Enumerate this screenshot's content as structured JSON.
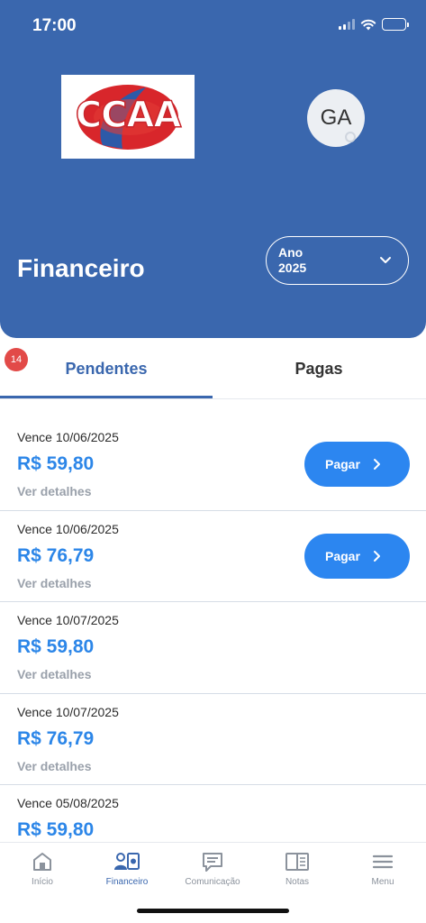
{
  "status_bar": {
    "time": "17:00"
  },
  "header": {
    "logo_text": "CCAA",
    "avatar_initials": "GA",
    "title": "Financeiro",
    "year_select": {
      "label": "Ano",
      "value": "2025"
    }
  },
  "tabs": [
    {
      "label": "Pendentes",
      "active": true,
      "badge": "14"
    },
    {
      "label": "Pagas",
      "active": false
    }
  ],
  "items": [
    {
      "due": "Vence 10/06/2025",
      "amount": "R$ 59,80",
      "details": "Ver detalhes",
      "pay_label": "Pagar"
    },
    {
      "due": "Vence 10/06/2025",
      "amount": "R$ 76,79",
      "details": "Ver detalhes",
      "pay_label": "Pagar"
    },
    {
      "due": "Vence 10/07/2025",
      "amount": "R$ 59,80",
      "details": "Ver detalhes"
    },
    {
      "due": "Vence 10/07/2025",
      "amount": "R$ 76,79",
      "details": "Ver detalhes"
    },
    {
      "due": "Vence 05/08/2025",
      "amount": "R$ 59,80"
    }
  ],
  "bottom_nav": [
    {
      "label": "Início",
      "icon": "home-icon"
    },
    {
      "label": "Financeiro",
      "icon": "finance-icon",
      "active": true
    },
    {
      "label": "Comunicação",
      "icon": "chat-icon"
    },
    {
      "label": "Notas",
      "icon": "notes-icon"
    },
    {
      "label": "Menu",
      "icon": "menu-icon"
    }
  ],
  "colors": {
    "header_bg": "#3a67ae",
    "accent": "#2c86e8",
    "badge": "#e24a48"
  }
}
